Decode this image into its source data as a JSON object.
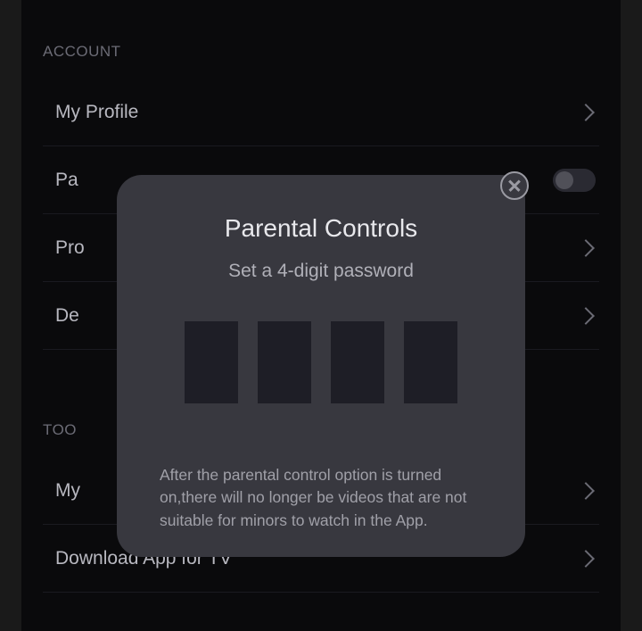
{
  "sections": {
    "account": {
      "header": "ACCOUNT",
      "items": [
        {
          "label": "My Profile",
          "trailing": "chevron"
        },
        {
          "label": "Pa",
          "trailing": "toggle"
        },
        {
          "label": "Pro",
          "trailing": "chevron"
        },
        {
          "label": "De",
          "trailing": "chevron"
        }
      ]
    },
    "tools": {
      "header": "TOO",
      "items": [
        {
          "label": "My",
          "trailing": "chevron"
        },
        {
          "label": "Download App for TV",
          "trailing": "chevron"
        }
      ]
    }
  },
  "modal": {
    "title": "Parental Controls",
    "subtitle": "Set a 4-digit password",
    "description": "After the parental control option is turned on,there will no longer be videos that are not suitable for minors to watch in the App."
  }
}
